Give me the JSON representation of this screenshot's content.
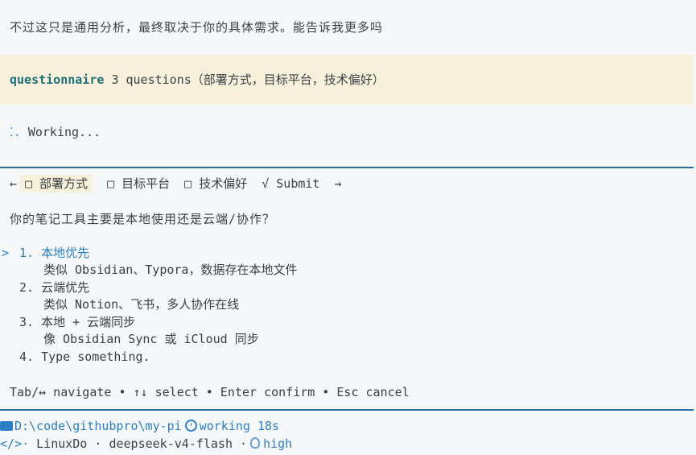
{
  "message": "不过这只是通用分析，最终取决于你的具体需求。能告诉我更多吗",
  "questionnaire": {
    "name": "questionnaire",
    "summary": "3 questions（部署方式，目标平台，技术偏好）"
  },
  "working": {
    "icon": "⁚.",
    "label": "Working..."
  },
  "tabs": {
    "back": "←",
    "items": [
      {
        "label": "□ 部署方式"
      },
      {
        "label": "□ 目标平台"
      },
      {
        "label": "□ 技术偏好"
      },
      {
        "label": "√ Submit"
      }
    ],
    "forward": "→"
  },
  "question": "你的笔记工具主要是本地使用还是云端/协作？",
  "cursor": ">",
  "options": [
    {
      "label": "1. 本地优先",
      "desc": "类似 Obsidian、Typora，数据存在本地文件"
    },
    {
      "label": "2. 云端优先",
      "desc": "类似 Notion、飞书，多人协作在线"
    },
    {
      "label": "3. 本地 + 云端同步",
      "desc": "像 Obsidian Sync 或 iCloud 同步"
    },
    {
      "label": "4. Type something."
    }
  ],
  "help": "Tab/↔ navigate • ↑↓ select • Enter confirm • Esc cancel",
  "status": {
    "path": "D:\\code\\githubpro\\my-pi",
    "state": "working 18s",
    "code_icon": "</>·",
    "provider": "LinuxDo",
    "sep1": "·",
    "model": "deepseek-v4-flash",
    "sep2": "·",
    "thinking": "high"
  },
  "colors": {
    "accent": "#2a7fc5",
    "banner": "#f7f1dc",
    "separator": "#2f6ea3",
    "question_name": "#1f6f78"
  }
}
